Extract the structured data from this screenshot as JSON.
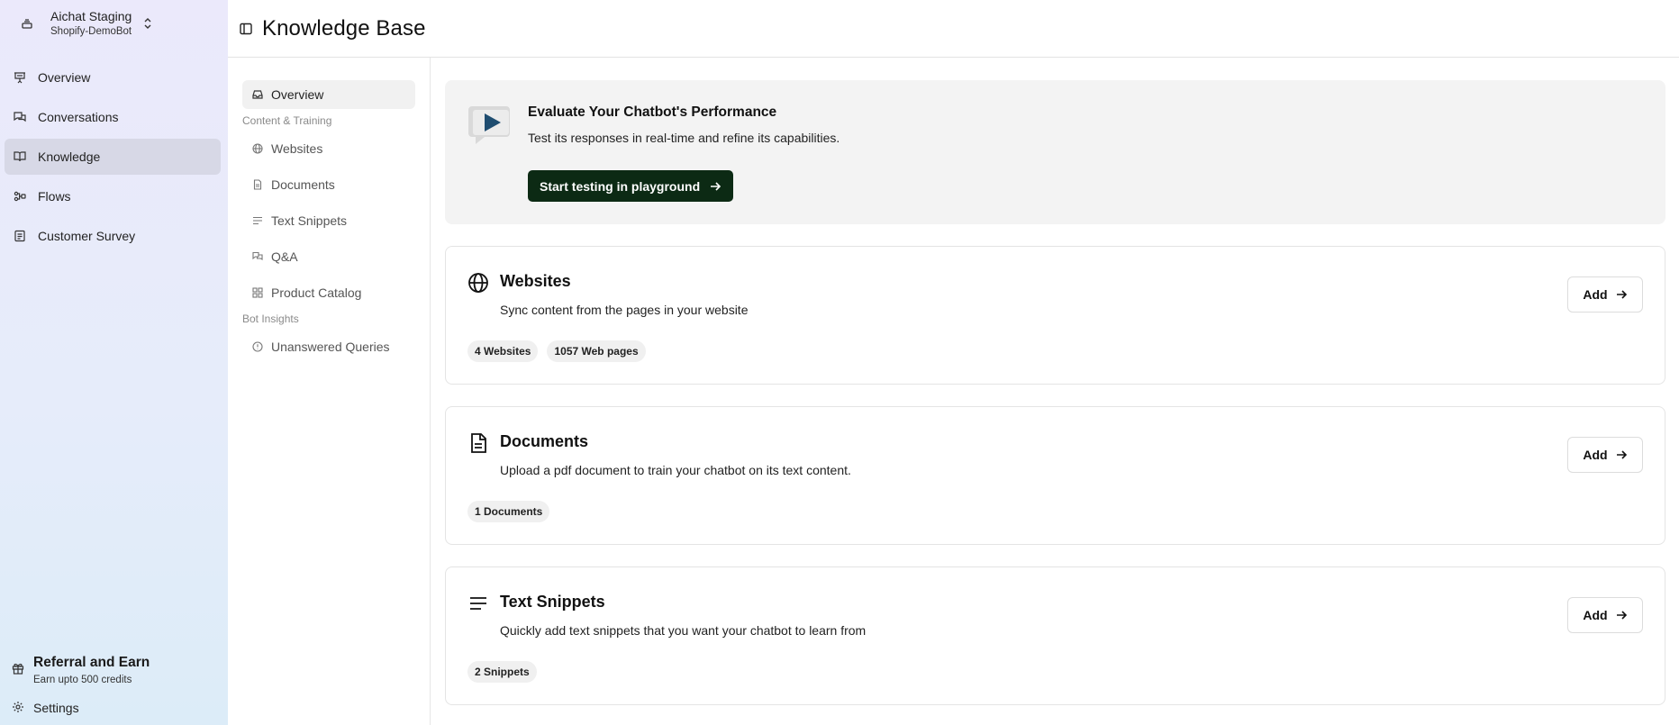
{
  "workspace": {
    "name": "Aichat Staging",
    "bot": "Shopify-DemoBot"
  },
  "sidebar": {
    "items": [
      {
        "label": "Overview",
        "icon": "presentation-icon"
      },
      {
        "label": "Conversations",
        "icon": "chat-icon"
      },
      {
        "label": "Knowledge",
        "icon": "book-icon",
        "active": true
      },
      {
        "label": "Flows",
        "icon": "flow-icon"
      },
      {
        "label": "Customer Survey",
        "icon": "survey-icon"
      }
    ],
    "referral": {
      "title": "Referral and Earn",
      "subtitle": "Earn upto 500 credits"
    },
    "settings_label": "Settings"
  },
  "header": {
    "title": "Knowledge Base"
  },
  "subnav": {
    "overview": "Overview",
    "section_content": "Content & Training",
    "websites": "Websites",
    "documents": "Documents",
    "text_snippets": "Text Snippets",
    "qa": "Q&A",
    "product_catalog": "Product Catalog",
    "section_insights": "Bot Insights",
    "unanswered": "Unanswered Queries"
  },
  "promo": {
    "title": "Evaluate Your Chatbot's Performance",
    "subtitle": "Test its responses in real-time and refine its capabilities.",
    "button": "Start testing in playground"
  },
  "cards": {
    "websites": {
      "title": "Websites",
      "desc": "Sync content from the pages in your website",
      "add": "Add",
      "chips": [
        "4 Websites",
        "1057 Web pages"
      ]
    },
    "documents": {
      "title": "Documents",
      "desc": "Upload a pdf document to train your chatbot on its text content.",
      "add": "Add",
      "chips": [
        "1 Documents"
      ]
    },
    "snippets": {
      "title": "Text Snippets",
      "desc": "Quickly add text snippets that you want your chatbot to learn from",
      "add": "Add",
      "chips": [
        "2 Snippets"
      ]
    }
  },
  "colors": {
    "primary_button": "#0c2a14",
    "sidebar_active": "#d7d8e6"
  }
}
